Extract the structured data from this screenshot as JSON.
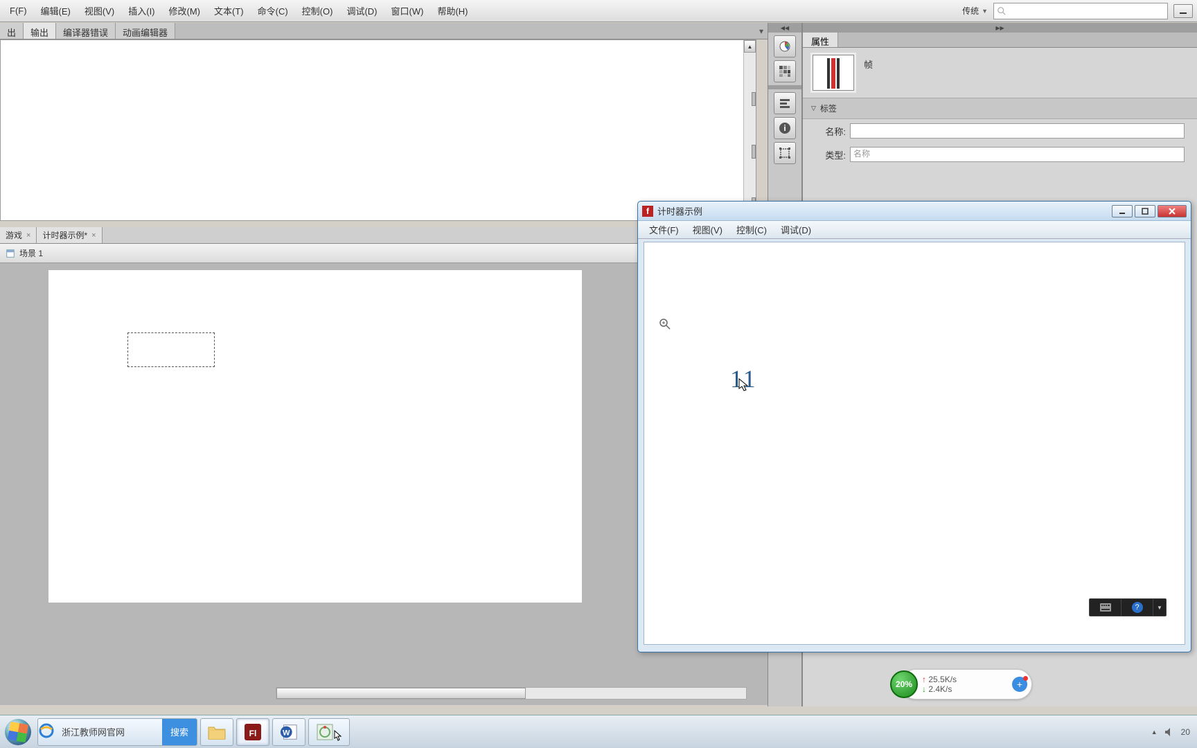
{
  "menu": {
    "file": "F(F)",
    "edit": "编辑(E)",
    "view": "视图(V)",
    "insert": "插入(I)",
    "modify": "修改(M)",
    "text": "文本(T)",
    "commands": "命令(C)",
    "control": "控制(O)",
    "debug": "调试(D)",
    "window": "窗口(W)",
    "help": "帮助(H)"
  },
  "workspace": {
    "label": "传统"
  },
  "search": {
    "placeholder": ""
  },
  "sec_tabs": {
    "t0": "出",
    "t1": "输出",
    "t2": "编译器错误",
    "t3": "动画编辑器"
  },
  "doc_tabs": {
    "t0": "游戏",
    "t1": "计时器示例*"
  },
  "scene": {
    "label": "场景 1"
  },
  "props": {
    "tab": "属性",
    "type": "帧",
    "section": "标签",
    "name_label": "名称:",
    "name_value": "",
    "type_label": "类型:",
    "type_value": "名称"
  },
  "popup": {
    "title": "计时器示例",
    "menu": {
      "file": "文件(F)",
      "view": "视图(V)",
      "control": "控制(C)",
      "debug": "调试(D)"
    },
    "counter": "11",
    "ime_help": "?"
  },
  "netmon": {
    "pct": "20%",
    "up": "25.5K/s",
    "down": "2.4K/s"
  },
  "taskbar": {
    "ie_text": "浙江教师网官网",
    "ie_search": "搜索",
    "time": "20"
  }
}
